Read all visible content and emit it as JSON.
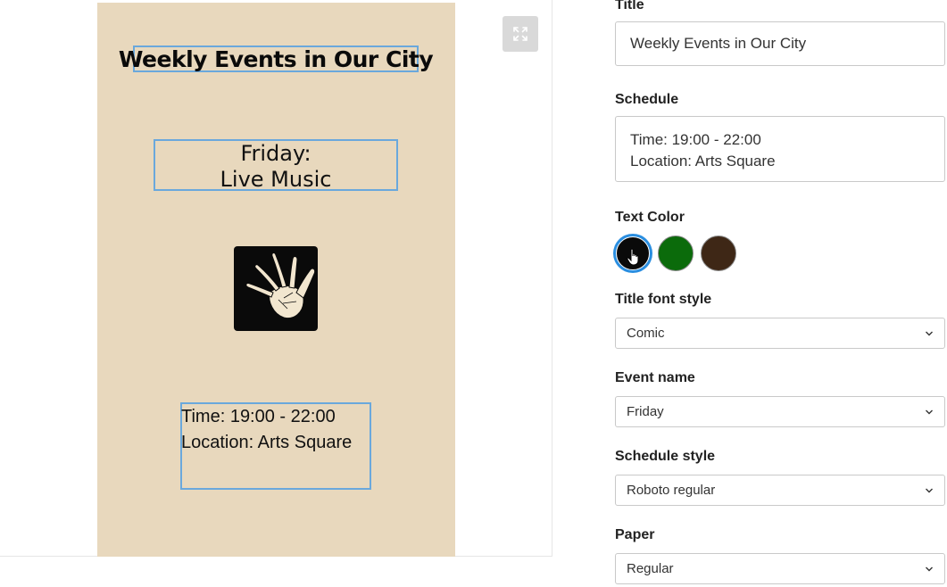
{
  "poster": {
    "title": "Weekly Events in Our City",
    "event_line1": "Friday:",
    "event_line2": "Live Music",
    "schedule_line1": "Time: 19:00 - 22:00",
    "schedule_line2": "Location: Arts Square",
    "icon": "hand-print-icon",
    "paper_color": "#e8d8bd"
  },
  "controls": {
    "title_label": "Title",
    "title_value": "Weekly Events in Our City",
    "schedule_label": "Schedule",
    "schedule_line1": "Time: 19:00 - 22:00",
    "schedule_line2": "Location: Arts Square",
    "text_color_label": "Text Color",
    "colors": [
      "#0a0a0a",
      "#0b6b0b",
      "#3e2716"
    ],
    "selected_color": "#0a0a0a",
    "title_font_label": "Title font style",
    "title_font_value": "Comic",
    "event_name_label": "Event name",
    "event_name_value": "Friday",
    "schedule_style_label": "Schedule style",
    "schedule_style_value": "Roboto regular",
    "paper_label": "Paper",
    "paper_value": "Regular"
  },
  "icons": {
    "expand": "expand-icon",
    "chevron": "chevron-down-icon",
    "cursor": "hand-cursor-icon"
  }
}
